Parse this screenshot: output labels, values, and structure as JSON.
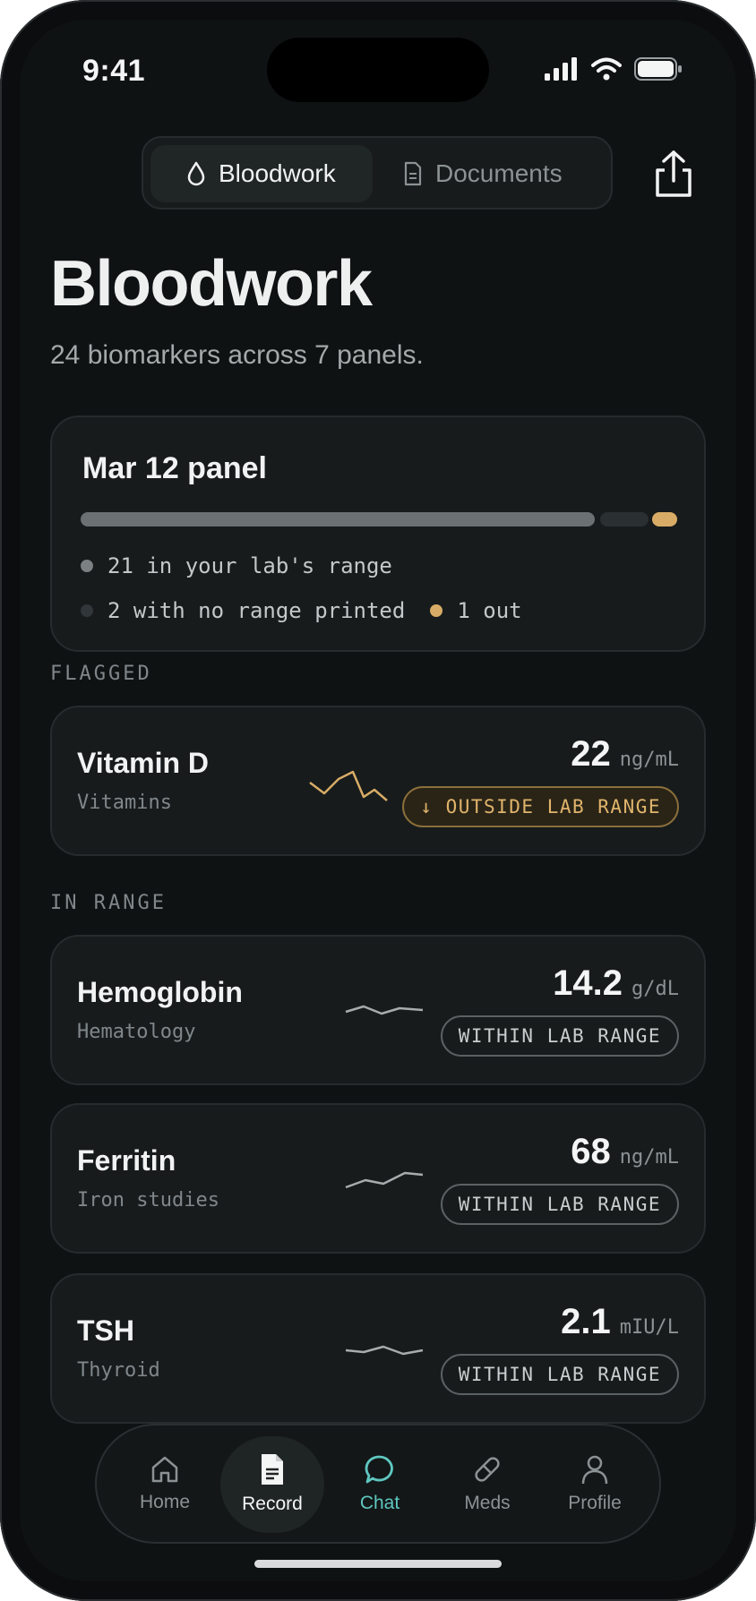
{
  "status": {
    "time": "9:41"
  },
  "segmented": {
    "bloodwork_label": "Bloodwork",
    "documents_label": "Documents"
  },
  "page": {
    "title": "Bloodwork",
    "subtitle": "24 biomarkers across 7 panels."
  },
  "panel": {
    "title": "Mar 12 panel",
    "in_range_text": "21 in your lab's range",
    "no_range_text": "2 with no range printed",
    "out_text": "1 out",
    "counts": {
      "in_range": 21,
      "no_range": 2,
      "out": 1
    }
  },
  "sections": {
    "flagged": "FLAGGED",
    "in_range": "IN RANGE"
  },
  "items": [
    {
      "name": "Vitamin D",
      "category": "Vitamins",
      "value": "22",
      "unit": "ng/mL",
      "status": "↓ OUTSIDE LAB RANGE"
    },
    {
      "name": "Hemoglobin",
      "category": "Hematology",
      "value": "14.2",
      "unit": "g/dL",
      "status": "WITHIN LAB RANGE"
    },
    {
      "name": "Ferritin",
      "category": "Iron studies",
      "value": "68",
      "unit": "ng/mL",
      "status": "WITHIN LAB RANGE"
    },
    {
      "name": "TSH",
      "category": "Thyroid",
      "value": "2.1",
      "unit": "mIU/L",
      "status": "WITHIN LAB RANGE"
    }
  ],
  "tabbar": {
    "home": "Home",
    "record": "Record",
    "chat": "Chat",
    "meds": "Meds",
    "profile": "Profile"
  },
  "colors": {
    "background": "#0f1213",
    "card": "#171b1c",
    "accent_warn": "#e0b46c",
    "accent_chat": "#5fc7c0"
  },
  "icons": [
    "drop-icon",
    "document-icon",
    "share-icon",
    "home-icon",
    "record-icon",
    "chat-icon",
    "pill-icon",
    "profile-icon"
  ]
}
